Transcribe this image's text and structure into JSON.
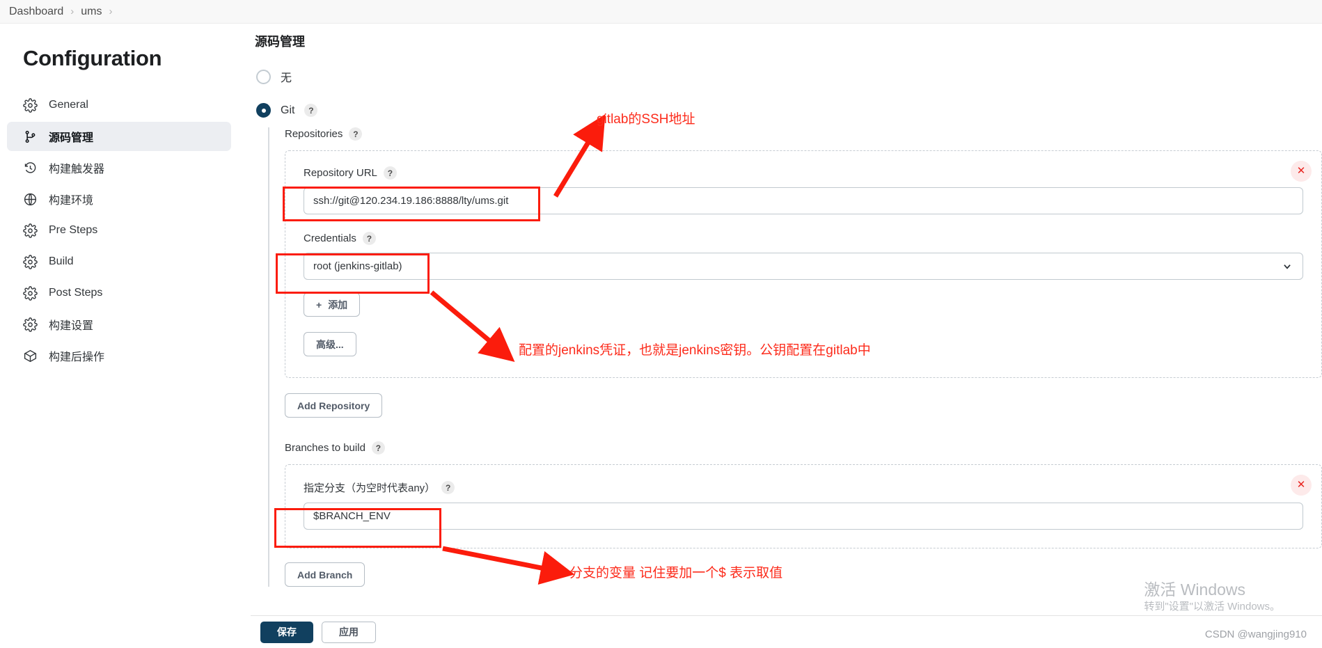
{
  "breadcrumb": {
    "items": [
      "Dashboard",
      "ums"
    ],
    "separator": "›"
  },
  "sidebar": {
    "title": "Configuration",
    "items": [
      {
        "label": "General",
        "icon": "gear-icon",
        "active": false
      },
      {
        "label": "源码管理",
        "icon": "git-branch-icon",
        "active": true
      },
      {
        "label": "构建触发器",
        "icon": "clock-icon",
        "active": false
      },
      {
        "label": "构建环境",
        "icon": "globe-icon",
        "active": false
      },
      {
        "label": "Pre Steps",
        "icon": "gear-icon",
        "active": false
      },
      {
        "label": "Build",
        "icon": "gear-icon",
        "active": false
      },
      {
        "label": "Post Steps",
        "icon": "gear-icon",
        "active": false
      },
      {
        "label": "构建设置",
        "icon": "gear-icon",
        "active": false
      },
      {
        "label": "构建后操作",
        "icon": "package-icon",
        "active": false
      }
    ]
  },
  "main": {
    "section_title": "源码管理",
    "scm_options": [
      {
        "label": "无",
        "checked": false,
        "help": false
      },
      {
        "label": "Git",
        "checked": true,
        "help": true
      }
    ],
    "help_glyph": "?",
    "repositories": {
      "label": "Repositories",
      "repo_url": {
        "label": "Repository URL",
        "value": "ssh://git@120.234.19.186:8888/lty/ums.git"
      },
      "credentials": {
        "label": "Credentials",
        "value": "root (jenkins-gitlab)"
      },
      "add_credential_button": "添加",
      "add_credential_plus": "+",
      "advanced_button": "高级...",
      "delete_glyph": "✕"
    },
    "add_repository_button": "Add Repository",
    "branches": {
      "label": "Branches to build",
      "branch_specifier": {
        "label": "指定分支（为空时代表any）",
        "value": "$BRANCH_ENV"
      },
      "delete_glyph": "✕"
    },
    "add_branch_button": "Add Branch"
  },
  "footer": {
    "save_button": "保存",
    "apply_button": "应用"
  },
  "annotations": [
    {
      "id": "anno-ssh",
      "text": "gitlab的SSH地址"
    },
    {
      "id": "anno-credentials",
      "text": "配置的jenkins凭证，也就是jenkins密钥。公钥配置在gitlab中"
    },
    {
      "id": "anno-branch",
      "text": "分支的变量 记住要加一个$  表示取值"
    }
  ],
  "watermark": {
    "activate_title": "激活 Windows",
    "activate_sub": "转到\"设置\"以激活 Windows。",
    "csdn": "CSDN @wangjing910"
  },
  "colors": {
    "accent": "#11405f",
    "annotation": "#fc2b1b",
    "active_nav_bg": "#eceef2",
    "danger": "#e8241f"
  }
}
